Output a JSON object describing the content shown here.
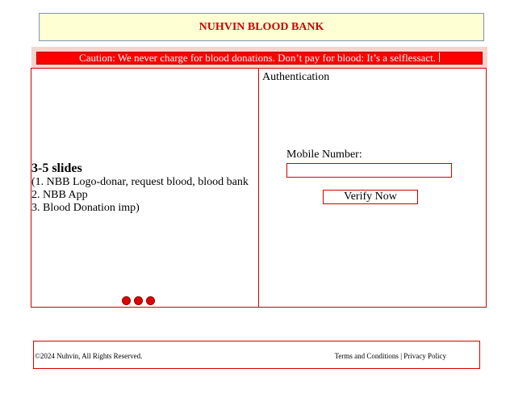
{
  "header": {
    "title": "NUHVIN BLOOD BANK"
  },
  "caution": {
    "text": "Caution: We never charge for blood donations. Don’t pay for blood: It’s a selflessact."
  },
  "slides": {
    "heading": "3-5 slides",
    "lines": [
      "(1. NBB Logo-donar, request blood, blood bank",
      "2. NBB App",
      "3. Blood Donation imp)"
    ],
    "dot_count": 3
  },
  "auth": {
    "title": "Authentication",
    "mobile_label": "Mobile Number:",
    "mobile_value": "",
    "verify_label": "Verify Now"
  },
  "footer": {
    "copyright": "©2024 Nuhvin, All Rights Reserved.",
    "terms": "Terms and Conditions",
    "separator": "|",
    "privacy": "Privacy Policy"
  },
  "colors": {
    "accent_red": "#ff0000",
    "header_bg": "#ffffd4",
    "caution_band": "#f6d4ce"
  }
}
